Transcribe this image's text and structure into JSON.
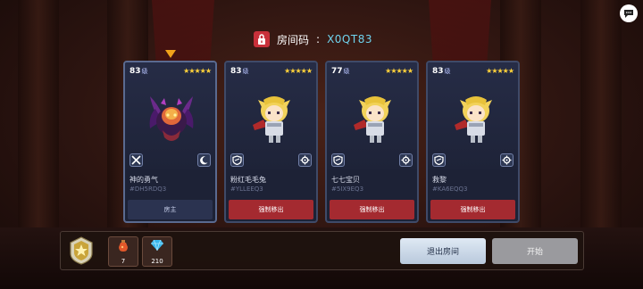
{
  "room": {
    "label": "房间码",
    "separator": ":",
    "code": "X0QT83"
  },
  "cards": [
    {
      "level": "83",
      "level_unit": "级",
      "stars": "★★★★★",
      "avatar": "demon-knight",
      "weapon_icon": "crossed-swords-icon",
      "skill_icon": "crescent-moon-icon",
      "name": "神的勇气",
      "uid": "#DH5RDQ3",
      "action": "房主",
      "is_host": true
    },
    {
      "level": "83",
      "level_unit": "级",
      "stars": "★★★★★",
      "avatar": "blonde-knight",
      "weapon_icon": "shield-icon",
      "skill_icon": "gear-icon",
      "name": "粉红毛毛兔",
      "uid": "#YLLEEQ3",
      "action": "强制移出",
      "is_host": false
    },
    {
      "level": "77",
      "level_unit": "级",
      "stars": "★★★★★",
      "avatar": "blonde-knight",
      "weapon_icon": "shield-icon",
      "skill_icon": "gear-icon",
      "name": "七七宝贝",
      "uid": "#5IX9EQ3",
      "action": "强制移出",
      "is_host": false
    },
    {
      "level": "83",
      "level_unit": "级",
      "stars": "★★★★★",
      "avatar": "blonde-knight",
      "weapon_icon": "shield-icon",
      "skill_icon": "gear-icon",
      "name": "救黎",
      "uid": "#KA6EQQ3",
      "action": "强制移出",
      "is_host": false
    }
  ],
  "resources": {
    "potion_count": "7",
    "gem_count": "210"
  },
  "buttons": {
    "leave": "退出房间",
    "start": "开始"
  },
  "icons": {
    "lock": "lock-icon",
    "chat": "chat-bubble-icon",
    "rank": "rank-emblem-icon",
    "potion": "potion-icon",
    "gem": "gem-icon",
    "host_marker": "arrow-down-icon"
  },
  "colors": {
    "room_code": "#6fd3ee",
    "kick_button": "#a42a30",
    "stars": "#ffd23a",
    "host_marker": "#f0a21a",
    "lock_badge": "#c8303a"
  }
}
